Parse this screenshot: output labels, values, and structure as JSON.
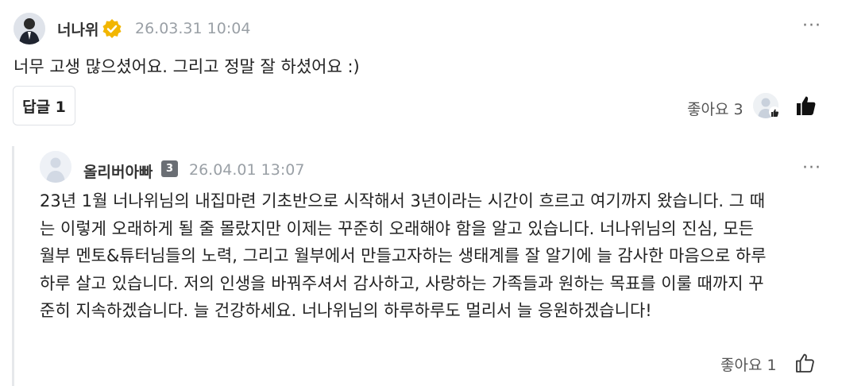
{
  "comment": {
    "author": "너나위",
    "timestamp": "26.03.31 10:04",
    "text": "너무 고생 많으셨어요. 그리고 정말 잘 하셨어요 :)",
    "more_label": "···",
    "reply_button_label": "답글 1",
    "like_label": "좋아요 3",
    "badge_icon": "verified-badge-icon",
    "accent_color": "#f2b600"
  },
  "reply": {
    "author": "올리버아빠",
    "level": "3",
    "timestamp": "26.04.01 13:07",
    "lines": [
      "23년 1월 너나위님의 내집마련 기초반으로 시작해서 3년이라는 시간이 흐르고 여기까지 왔습니다. 그 때",
      "는 이렇게 오래하게 될 줄 몰랐지만 이제는 꾸준히 오래해야 함을 알고 있습니다. 너나위님의 진심, 모든",
      "월부 멘토&튜터님들의 노력, 그리고 월부에서 만들고자하는 생태계를 잘 알기에 늘 감사한 마음으로 하루",
      "하루 살고 있습니다. 저의 인생을 바꿔주셔서 감사하고, 사랑하는 가족들과 원하는 목표를 이룰 때까지 꾸",
      "준히 지속하겠습니다. 늘 건강하세요. 너나위님의 하루하루도 멀리서 늘 응원하겠습니다!"
    ],
    "more_label": "···",
    "like_label": "좋아요 1"
  }
}
